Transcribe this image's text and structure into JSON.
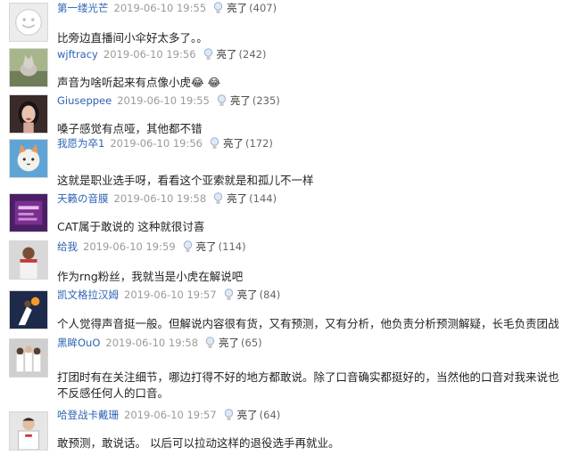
{
  "like_label": "亮了",
  "comments": [
    {
      "user": "第一缕光芒",
      "time": "2019-06-10 19:55",
      "likes": "(407)",
      "text": "比旁边直播间小伞好太多了。。",
      "avatar_icon": "default-face-avatar"
    },
    {
      "user": "wjftracy",
      "time": "2019-06-10 19:56",
      "likes": "(242)",
      "text": "声音为啥听起来有点像小虎😂 😂",
      "avatar_icon": "cat-photo-avatar"
    },
    {
      "user": "Giuseppee",
      "time": "2019-06-10 19:55",
      "likes": "(235)",
      "text": "嗓子感觉有点哑，其他都不错",
      "avatar_icon": "woman-photo-avatar"
    },
    {
      "user": "我愿为卒1",
      "time": "2019-06-10 19:56",
      "likes": "(172)",
      "text": "这就是职业选手呀，看看这个亚索就是和孤儿不一样",
      "avatar_icon": "cartoon-cat-avatar"
    },
    {
      "user": "天籁の音膜",
      "time": "2019-06-10 19:58",
      "likes": "(144)",
      "text": "CAT属于敢说的 这种就很讨喜",
      "avatar_icon": "poster-avatar"
    },
    {
      "user": "给我",
      "time": "2019-06-10 19:59",
      "likes": "(114)",
      "text": "作为rng粉丝，我就当是小虎在解说吧",
      "avatar_icon": "basketball-player-avatar"
    },
    {
      "user": "凯文格拉汉姆",
      "time": "2019-06-10 19:57",
      "likes": "(84)",
      "text": "个人觉得声音挺一般。但解说内容很有货，又有预测，又有分析，他负责分析预测解疑，长毛负责团战",
      "avatar_icon": "dunk-photo-avatar"
    },
    {
      "user": "黑眸OuO",
      "time": "2019-06-10 19:58",
      "likes": "(65)",
      "text": "打团时有在关注细节，哪边打得不好的地方都敢说。除了口音确实都挺好的，当然他的口音对我来说也不反感任何人的口音。",
      "avatar_icon": "team-photo-avatar"
    },
    {
      "user": "哈登战卡戴珊",
      "time": "2019-06-10 19:57",
      "likes": "(64)",
      "text": "敢预测，敢说话。 以后可以拉动这样的退役选手再就业。",
      "avatar_icon": "player-photo-avatar"
    }
  ]
}
